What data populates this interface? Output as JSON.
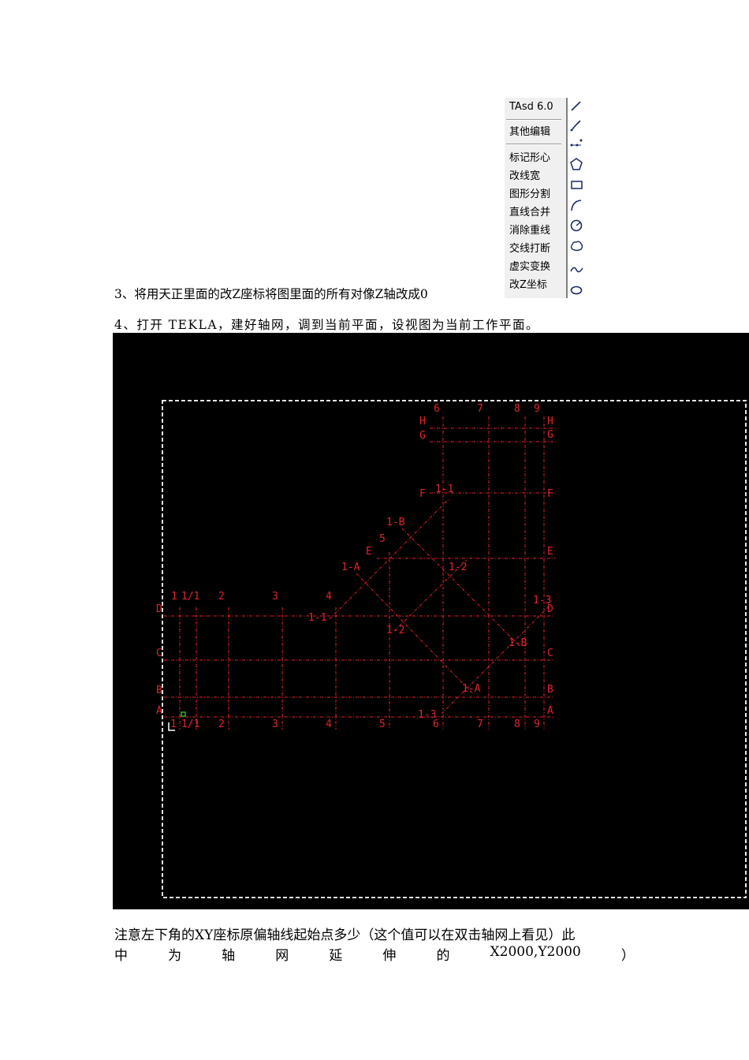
{
  "menu": {
    "title": "TAsd 6.0",
    "section": "其他编辑",
    "items": [
      "标记形心",
      "改线宽",
      "图形分割",
      "直线合并",
      "消除重线",
      "交线打断",
      "虚实变换",
      "改Z坐标"
    ],
    "icons": [
      "line-icon",
      "polyline-icon",
      "dots-icon",
      "pentagon-icon",
      "rectangle-icon",
      "arc-icon",
      "circle-icon",
      "cloud-icon",
      "spline-icon",
      "ellipse-icon"
    ]
  },
  "text": {
    "step3": "3、将用天正里面的改Z座标将图里面的所有对像Z轴改成0",
    "step4": "4、打开 TEKLA，建好轴网，调到当前平面，设视图为当前工作平面。",
    "note_line1": "注意左下角的XY座标原偏轴线起始点多少（这个值可以在双击轴网上看见）此",
    "note_line2": [
      "中",
      "为",
      "轴",
      "网",
      "延",
      "伸",
      "的",
      "X2000,Y2000",
      "）"
    ]
  },
  "grid": {
    "colors": {
      "background": "#000000",
      "grid": "#e0242c",
      "frame": "#e8e8e8",
      "axis_x": "#30e030",
      "axis_y": "#ffffff"
    },
    "top_labels": [
      "1",
      "1/1",
      "2",
      "3",
      "4",
      "6",
      "7",
      "8",
      "9"
    ],
    "bottom_labels": [
      "1",
      "1/1",
      "2",
      "3",
      "4",
      "5",
      "6",
      "7",
      "8",
      "9"
    ],
    "left_labels": [
      "D",
      "C",
      "B",
      "A"
    ],
    "right_labels": [
      "H",
      "G",
      "F",
      "E",
      "D",
      "C",
      "B",
      "A"
    ],
    "upper_left_labels": [
      "H",
      "G",
      "F",
      "E"
    ],
    "diagonal_labels": [
      "1-1",
      "1-B",
      "5",
      "1-A",
      "1-2",
      "1-1",
      "1-2",
      "1-3",
      "1-B",
      "1-A",
      "1-3"
    ]
  }
}
